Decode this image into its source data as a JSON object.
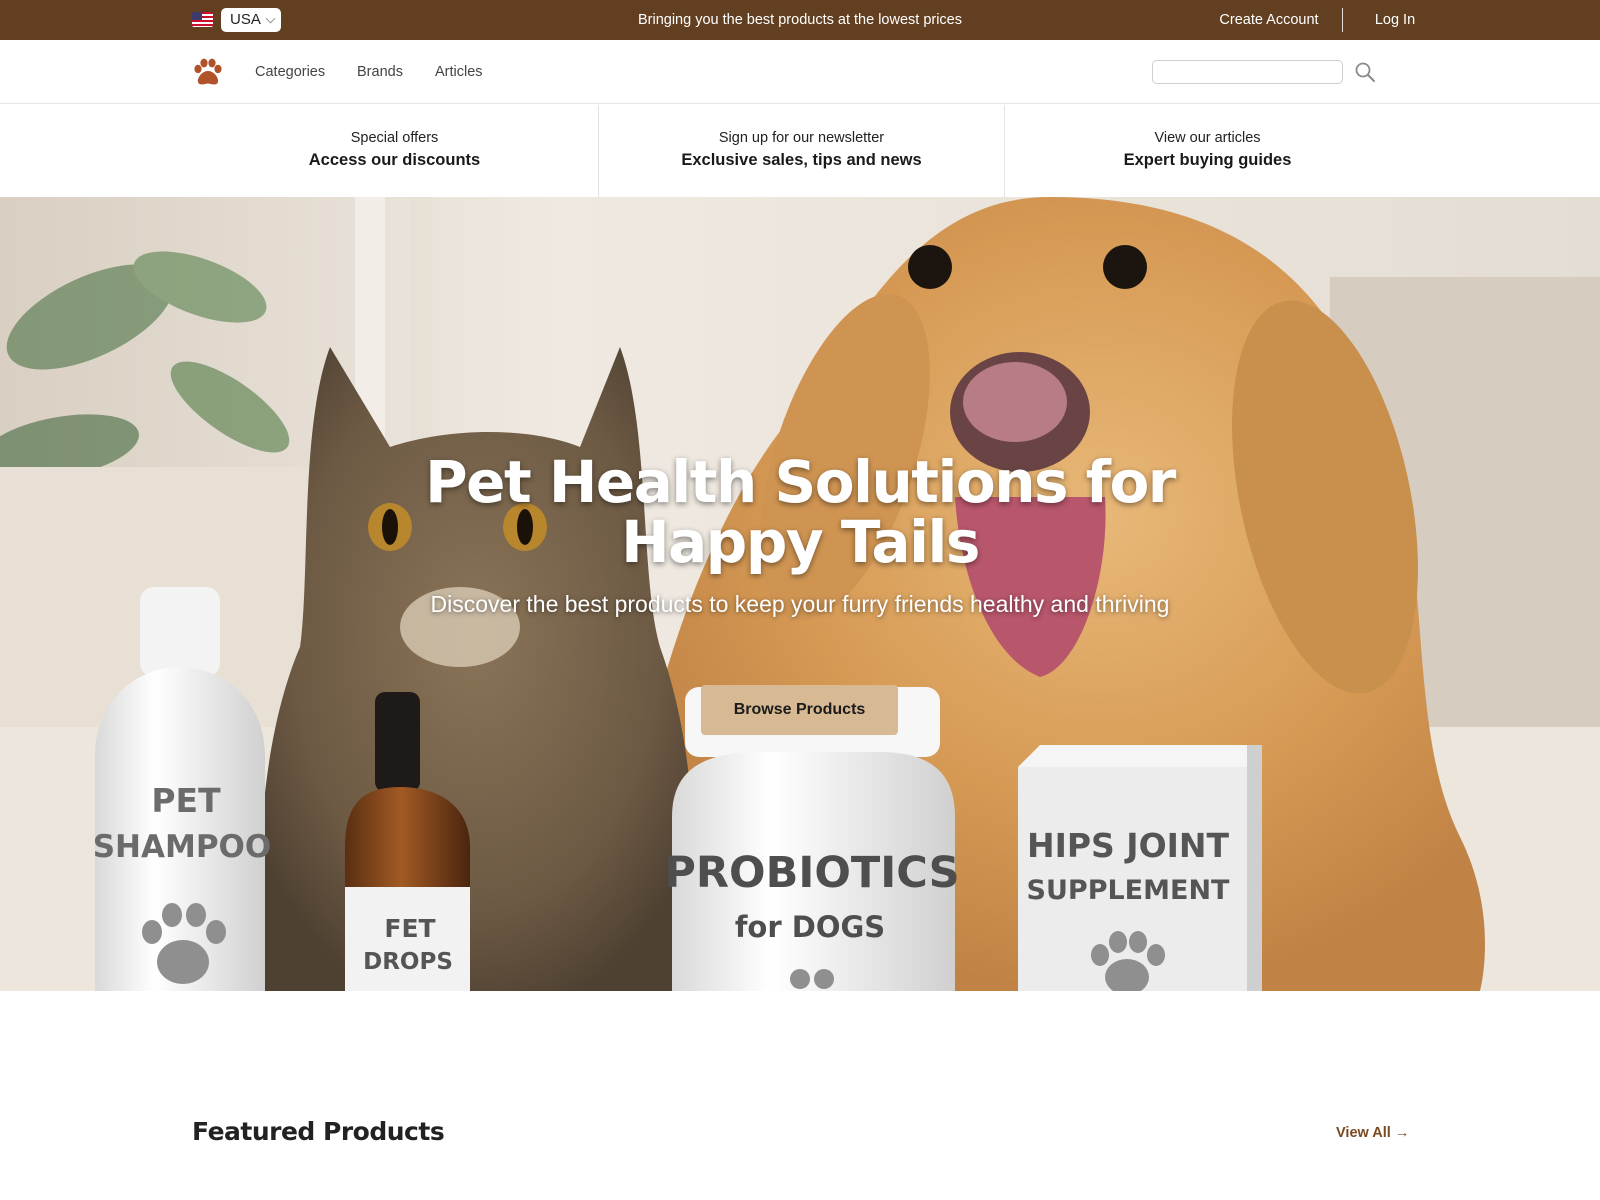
{
  "topbar": {
    "country": "USA",
    "tagline": "Bringing you the best products at the lowest prices",
    "create_account": "Create Account",
    "log_in": "Log In",
    "background_color": "#623f20"
  },
  "nav": {
    "logo_icon": "paw-icon",
    "links": [
      "Categories",
      "Brands",
      "Articles"
    ],
    "search": {
      "value": "",
      "placeholder": "",
      "icon": "search-icon"
    }
  },
  "promos": [
    {
      "label": "Special offers",
      "title": "Access our discounts"
    },
    {
      "label": "Sign up for our newsletter",
      "title": "Exclusive sales, tips and news"
    },
    {
      "label": "View our articles",
      "title": "Expert buying guides"
    }
  ],
  "hero": {
    "title": "Pet Health Solutions for Happy Tails",
    "subtitle": "Discover the best products to keep your furry friends healthy and thriving",
    "cta": "Browse Products",
    "cta_color": "#d7b993",
    "image_labels": {
      "shampoo": [
        "PET",
        "SHAMPOO"
      ],
      "drops": [
        "FET",
        "DROPS"
      ],
      "probiotics": [
        "PROBIOTICS",
        "for DOGS"
      ],
      "supplement": [
        "HIPS JOINT",
        "SUPPLEMENT"
      ]
    }
  },
  "featured": {
    "title": "Featured Products",
    "view_all": "View All",
    "accent_color": "#7a4a22"
  }
}
